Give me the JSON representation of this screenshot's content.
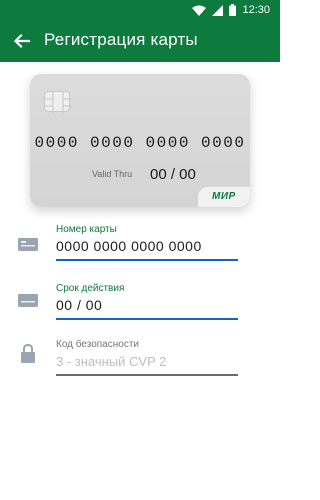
{
  "status_bar": {
    "time": "12:30"
  },
  "app_bar": {
    "title": "Регистрация карты"
  },
  "card": {
    "number": "0000 0000 0000 0000",
    "valid_label": "Valid Thru",
    "valid_value": "00 / 00",
    "brand": "МИР"
  },
  "fields": {
    "card_number": {
      "label": "Номер карты",
      "value": "0000 0000 0000 0000"
    },
    "expiry": {
      "label": "Срок действия",
      "value": "00 / 00"
    },
    "cvv": {
      "label": "Код безопасности",
      "placeholder": "3 - значный CVP 2"
    }
  },
  "colors": {
    "primary": "#0d7a3e",
    "focus_underline": "#1565c0"
  },
  "icons": [
    "wifi-icon",
    "signal-icon",
    "battery-icon",
    "back-arrow-icon",
    "chip-icon",
    "card-icon",
    "card-icon",
    "lock-icon"
  ]
}
